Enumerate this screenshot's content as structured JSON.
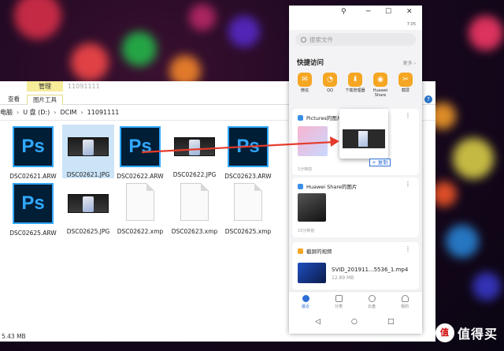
{
  "explorer": {
    "ribbon_context": "管理",
    "ribbon_title": "11091111",
    "tab_view": "查看",
    "tab_picture_tools": "图片工具",
    "breadcrumb": [
      "电脑",
      "U 盘 (D:)",
      "DCIM",
      "11091111"
    ],
    "files_row1": [
      {
        "name": "DSC02621.ARW",
        "kind": "ps"
      },
      {
        "name": "DSC02621.JPG",
        "kind": "photo",
        "selected": true
      },
      {
        "name": "DSC02622.ARW",
        "kind": "ps"
      },
      {
        "name": "DSC02622.JPG",
        "kind": "photo"
      },
      {
        "name": "DSC02623.ARW",
        "kind": "ps"
      }
    ],
    "files_row2": [
      {
        "name": "DSC02625.ARW",
        "kind": "ps"
      },
      {
        "name": "DSC02625.JPG",
        "kind": "photo"
      },
      {
        "name": "DSC02622.xmp",
        "kind": "doc"
      },
      {
        "name": "DSC02623.xmp",
        "kind": "doc"
      },
      {
        "name": "DSC02625.xmp",
        "kind": "doc"
      }
    ],
    "status": "5.43 MB"
  },
  "phone": {
    "status_left": "",
    "status_right": "7:05",
    "search_placeholder": "搜索文件",
    "quick_access_title": "快捷访问",
    "more_label": "更多",
    "quick_items": [
      {
        "label": "微信",
        "icon": "wechat-icon",
        "glyph": "✉"
      },
      {
        "label": "QQ",
        "icon": "qq-icon",
        "glyph": "◔"
      },
      {
        "label": "下载管理器",
        "icon": "download-icon",
        "glyph": "⬇"
      },
      {
        "label": "Huawei Share",
        "icon": "huawei-share-icon",
        "glyph": "◉"
      },
      {
        "label": "截屏",
        "icon": "screenshot-icon",
        "glyph": "✂"
      }
    ],
    "pictures_card": {
      "title": "Pictures的图片",
      "footer": "1分钟前"
    },
    "drag_copy_label": "+ 复制",
    "share_card": {
      "title": "Huawei Share的图片",
      "footer": "15分钟前"
    },
    "video_card": {
      "title": "截屏的视频",
      "file_name": "SVID_201911...5536_1.mp4",
      "file_size": "12.89 MB"
    },
    "nav": [
      "最近",
      "分类",
      "云盘",
      "我的"
    ],
    "brand": "值得买",
    "colors": {
      "accent": "#2f6fd6",
      "quick_icon": "#f5a623"
    }
  }
}
